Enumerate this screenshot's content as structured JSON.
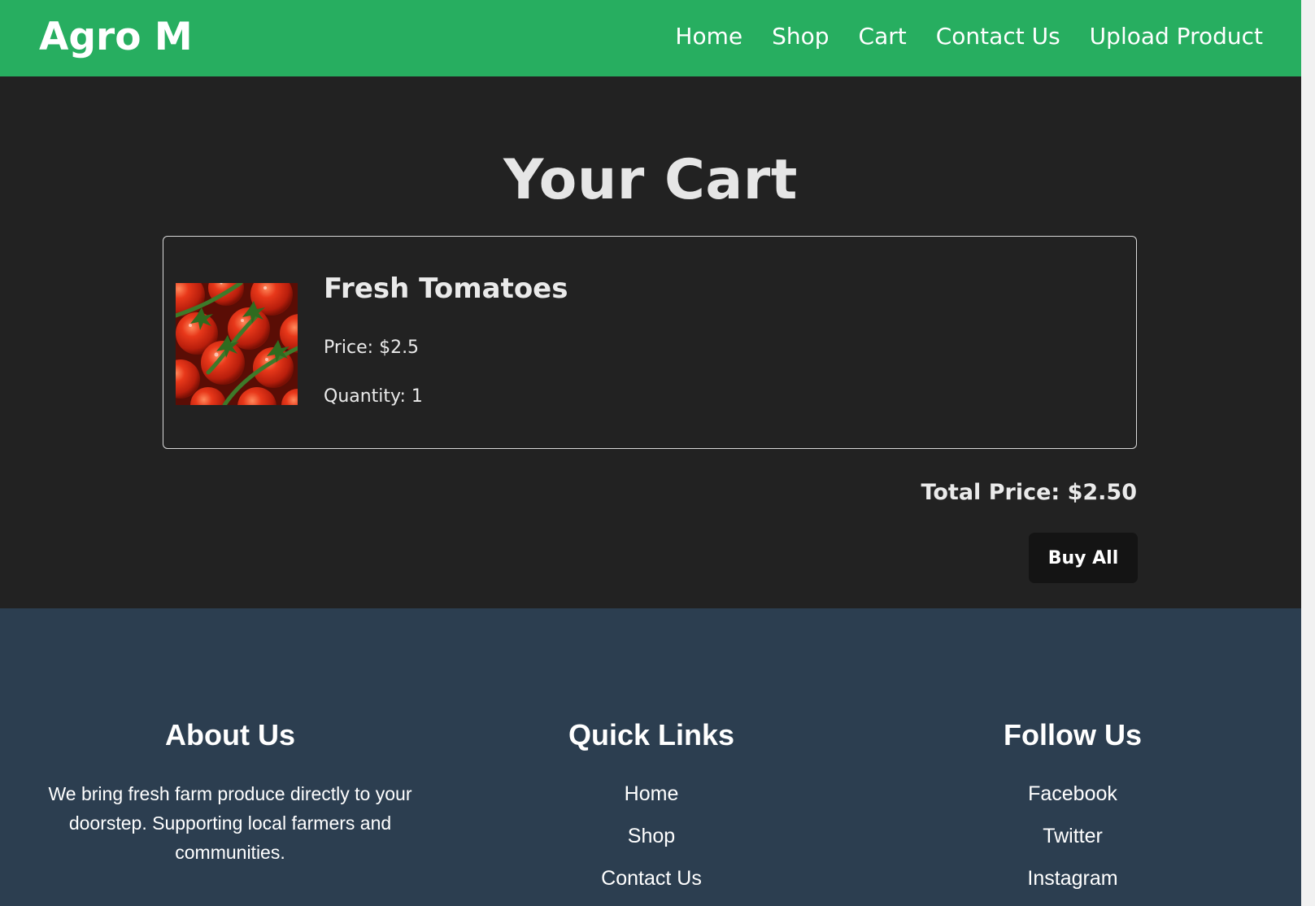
{
  "header": {
    "logo": "Agro M",
    "nav": [
      "Home",
      "Shop",
      "Cart",
      "Contact Us",
      "Upload Product"
    ]
  },
  "main": {
    "title": "Your Cart",
    "items": [
      {
        "name": "Fresh Tomatoes",
        "price": "Price: $2.5",
        "quantity": "Quantity: 1",
        "image": "tomatoes-photo"
      }
    ],
    "total": "Total Price: $2.50",
    "buy_all_label": "Buy All"
  },
  "footer": {
    "about": {
      "heading": "About Us",
      "text": "We bring fresh farm produce directly to your doorstep. Supporting local farmers and communities."
    },
    "quick_links": {
      "heading": "Quick Links",
      "links": [
        "Home",
        "Shop",
        "Contact Us"
      ]
    },
    "follow": {
      "heading": "Follow Us",
      "links": [
        "Facebook",
        "Twitter",
        "Instagram"
      ]
    }
  },
  "colors": {
    "header_bg": "#27ae60",
    "page_bg": "#222222",
    "footer_bg": "#2c3e50",
    "button_bg": "#141414"
  }
}
